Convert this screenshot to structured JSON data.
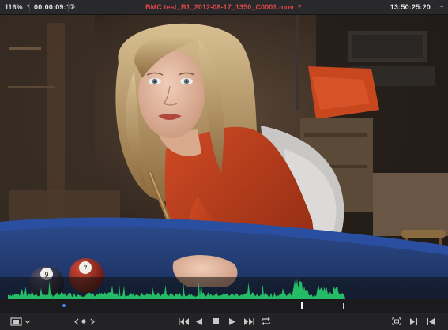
{
  "topbar": {
    "zoom": "116%",
    "timecode": "00:00:09:17",
    "clip_name": "BMC test_B1_2012-08-17_1350_C0001.mov",
    "source_timecode": "13:50:25:20",
    "options_label": "···"
  },
  "colors": {
    "clip_name": "#e04848",
    "waveform": "#27c46a",
    "marker": "#3a86e8",
    "background": "#1e1e20"
  },
  "icons": {
    "viewer_options": "monitor-icon",
    "prev_clip": "chevron-left-icon",
    "next_clip": "chevron-right-icon",
    "first_frame": "skip-back-icon",
    "play_reverse": "play-reverse-icon",
    "stop": "stop-icon",
    "play": "play-icon",
    "last_frame": "skip-forward-icon",
    "loop": "loop-icon",
    "fullscreen": "fullscreen-icon",
    "match_frame": "match-frame-icon",
    "out_point": "out-point-icon"
  },
  "scrubber": {
    "playhead_position": 0.68,
    "in_point": 0.41,
    "out_point": 0.78,
    "marker_position": 0.12
  },
  "viewer": {
    "billiard_balls": [
      "9",
      "7"
    ]
  }
}
